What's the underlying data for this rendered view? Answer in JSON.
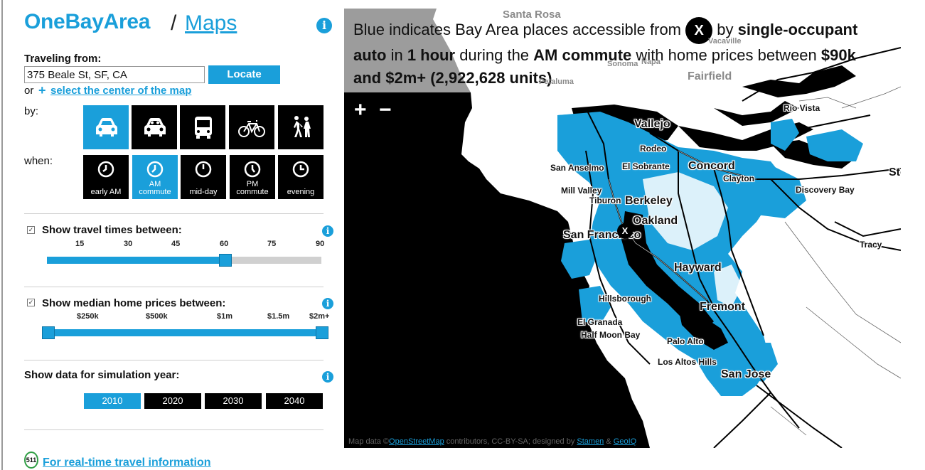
{
  "brand": {
    "logo_text": "OneBayArea",
    "separator": "/",
    "maps_link": "Maps"
  },
  "colors": {
    "accent": "#1a9fda",
    "black": "#000000",
    "track_off": "#d0d0d0",
    "gray_land": "#9c9c9c"
  },
  "icons": {
    "info": "info-icon",
    "plus": "plus-icon",
    "car": "car-icon",
    "bike": "bicycle-icon",
    "bus": "bus-icon",
    "walk": "walk-icon",
    "clock": "clock-icon"
  },
  "travel": {
    "from_label": "Traveling from:",
    "address_value": "375 Beale St, SF, CA",
    "locate_label": "Locate",
    "or_label": "or",
    "center_link": "select the center of the map",
    "by_label": "by:",
    "when_label": "when:",
    "modes": [
      {
        "name": "single-occupant auto",
        "selected": true
      },
      {
        "name": "carpool",
        "selected": false
      },
      {
        "name": "transit",
        "selected": false
      },
      {
        "name": "bicycle",
        "selected": false
      },
      {
        "name": "walk",
        "selected": false
      }
    ],
    "times": [
      {
        "line1": "early AM",
        "line2": "",
        "selected": false
      },
      {
        "line1": "AM",
        "line2": "commute",
        "selected": true
      },
      {
        "line1": "mid-day",
        "line2": "",
        "selected": false
      },
      {
        "line1": "PM",
        "line2": "commute",
        "selected": false
      },
      {
        "line1": "evening",
        "line2": "",
        "selected": false
      }
    ]
  },
  "travel_times": {
    "checked": true,
    "label": "Show travel times between:",
    "ticks": [
      "15",
      "30",
      "45",
      "60",
      "75",
      "90"
    ],
    "range_min": 0,
    "range_max": 60
  },
  "home_prices": {
    "checked": true,
    "label": "Show median home prices between:",
    "ticks": [
      "$250k",
      "$500k",
      "$1m",
      "$1.5m",
      "$2m+"
    ],
    "range_low": "$90k",
    "range_high": "$2m+"
  },
  "simulation": {
    "label": "Show data for simulation year:",
    "years": [
      {
        "label": "2010",
        "selected": true
      },
      {
        "label": "2020",
        "selected": false
      },
      {
        "label": "2030",
        "selected": false
      },
      {
        "label": "2040",
        "selected": false
      }
    ]
  },
  "footer": {
    "badge_text": "511",
    "realtime_link": "For real-time travel information"
  },
  "map": {
    "caption": {
      "p1": "Blue indicates Bay Area places accessible from",
      "marker": "X",
      "p2": "by",
      "mode": "single-occupant auto",
      "p3": "in",
      "duration": "1 hour",
      "p4": "during the",
      "period": "AM commute",
      "p5": "with home prices between",
      "prices": "$90k and $2m+",
      "units": "(2,922,628 units)"
    },
    "zoom_in": "+",
    "zoom_out": "−",
    "start_marker": "X",
    "cities": [
      {
        "name": "Santa Rosa",
        "style": "gray"
      },
      {
        "name": "Vacaville",
        "style": "gray"
      },
      {
        "name": "Napa",
        "style": "gray"
      },
      {
        "name": "Sonoma",
        "style": "gray"
      },
      {
        "name": "Petaluma",
        "style": "gray"
      },
      {
        "name": "Fairfield",
        "style": "gray"
      },
      {
        "name": "Rio Vista",
        "style": "small"
      },
      {
        "name": "Vallejo",
        "style": "big"
      },
      {
        "name": "Rodeo",
        "style": "small"
      },
      {
        "name": "San Anselmo",
        "style": "small"
      },
      {
        "name": "El Sobrante",
        "style": "small"
      },
      {
        "name": "Concord",
        "style": "big"
      },
      {
        "name": "Clayton",
        "style": "small"
      },
      {
        "name": "Sto",
        "style": "big"
      },
      {
        "name": "Discovery Bay",
        "style": "small"
      },
      {
        "name": "Mill Valley",
        "style": "small"
      },
      {
        "name": "Tiburon",
        "style": "small"
      },
      {
        "name": "Berkeley",
        "style": "big"
      },
      {
        "name": "Oakland",
        "style": "big"
      },
      {
        "name": "San Francisco",
        "style": "big"
      },
      {
        "name": "Tracy",
        "style": "small"
      },
      {
        "name": "Hayward",
        "style": "big"
      },
      {
        "name": "Hillsborough",
        "style": "small"
      },
      {
        "name": "Fremont",
        "style": "big"
      },
      {
        "name": "El Granada",
        "style": "small"
      },
      {
        "name": "Half Moon Bay",
        "style": "small"
      },
      {
        "name": "Palo Alto",
        "style": "small"
      },
      {
        "name": "Los Altos Hills",
        "style": "small"
      },
      {
        "name": "San Jose",
        "style": "big"
      }
    ],
    "attribution": {
      "prefix": "Map data ©",
      "osm_link": "OpenStreetMap",
      "middle": "contributors, CC-BY-SA; designed by",
      "stamen_link": "Stamen",
      "amp": "&",
      "geoiq_link": "GeoIQ"
    }
  }
}
